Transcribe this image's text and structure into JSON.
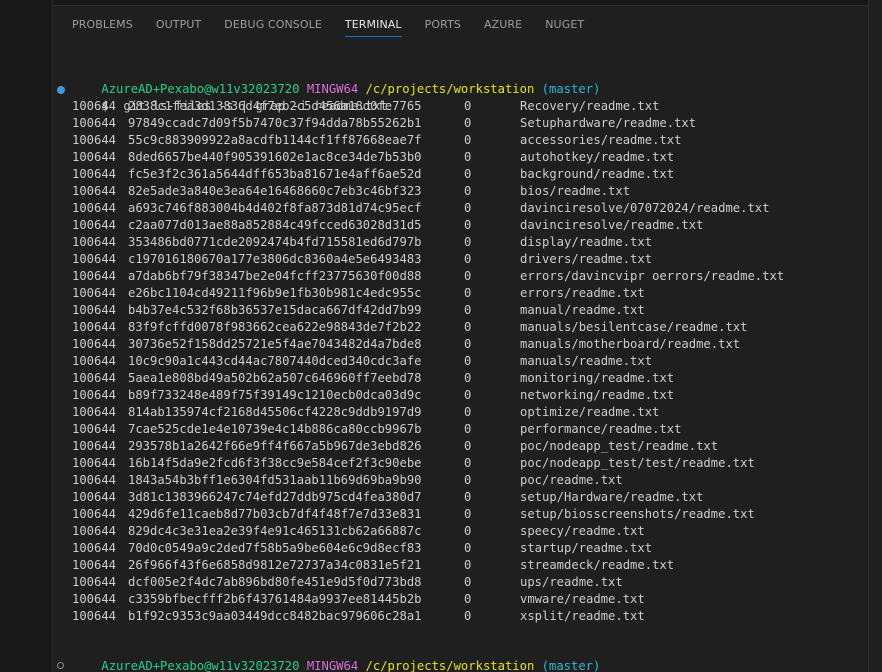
{
  "panel": {
    "tabs": [
      {
        "label": "PROBLEMS",
        "active": false
      },
      {
        "label": "OUTPUT",
        "active": false
      },
      {
        "label": "DEBUG CONSOLE",
        "active": false
      },
      {
        "label": "TERMINAL",
        "active": true
      },
      {
        "label": "PORTS",
        "active": false
      },
      {
        "label": "AZURE",
        "active": false
      },
      {
        "label": "NUGET",
        "active": false
      }
    ],
    "accent_color": "#0078d4"
  },
  "terminal": {
    "prompt1": {
      "user": "AzureAD+Pexabo@w11v32023720",
      "system": "MINGW64",
      "path": "/c/projects/workstation",
      "branch": "(master)"
    },
    "command": {
      "symbol": "$",
      "text": "git ls-files -s | grep -i readme.txt"
    },
    "rows": [
      {
        "mode": "100644",
        "hash": "2838c1fea3d13836d4f7eb2c5d456a18d0fe7765",
        "stage": "0",
        "file": "Recovery/readme.txt"
      },
      {
        "mode": "100644",
        "hash": "97849ccadc7d09f5b7470c37f94dda78b55262b1",
        "stage": "0",
        "file": "Setuphardware/readme.txt"
      },
      {
        "mode": "100644",
        "hash": "55c9c883909922a8acdfb1144cf1ff87668eae7f",
        "stage": "0",
        "file": "accessories/readme.txt"
      },
      {
        "mode": "100644",
        "hash": "8ded6657be440f905391602e1ac8ce34de7b53b0",
        "stage": "0",
        "file": "autohotkey/readme.txt"
      },
      {
        "mode": "100644",
        "hash": "fc5e3f2c361a5644dff653ba81671e4aff6ae52d",
        "stage": "0",
        "file": "background/readme.txt"
      },
      {
        "mode": "100644",
        "hash": "82e5ade3a840e3ea64e16468660c7eb3c46bf323",
        "stage": "0",
        "file": "bios/readme.txt"
      },
      {
        "mode": "100644",
        "hash": "a693c746f883004b4d402f8fa873d81d74c95ecf",
        "stage": "0",
        "file": "davinciresolve/07072024/readme.txt"
      },
      {
        "mode": "100644",
        "hash": "c2aa077d013ae88a852884c49fcced63028d31d5",
        "stage": "0",
        "file": "davinciresolve/readme.txt"
      },
      {
        "mode": "100644",
        "hash": "353486bd0771cde2092474b4fd715581ed6d797b",
        "stage": "0",
        "file": "display/readme.txt"
      },
      {
        "mode": "100644",
        "hash": "c197016180670a177e3806dc8360a4e5e6493483",
        "stage": "0",
        "file": "drivers/readme.txt"
      },
      {
        "mode": "100644",
        "hash": "a7dab6bf79f38347be2e04fcff23775630f00d88",
        "stage": "0",
        "file": "errors/davincvipr oerrors/readme.txt"
      },
      {
        "mode": "100644",
        "hash": "e26bc1104cd49211f96b9e1fb30b981c4edc955c",
        "stage": "0",
        "file": "errors/readme.txt"
      },
      {
        "mode": "100644",
        "hash": "b4b37e4c532f68b36537e15daca667df42dd7b99",
        "stage": "0",
        "file": "manual/readme.txt"
      },
      {
        "mode": "100644",
        "hash": "83f9fcffd0078f983662cea622e98843de7f2b22",
        "stage": "0",
        "file": "manuals/besilentcase/readme.txt"
      },
      {
        "mode": "100644",
        "hash": "30736e52f158dd25721e5f4ae7043482d4a7bde8",
        "stage": "0",
        "file": "manuals/motherboard/readme.txt"
      },
      {
        "mode": "100644",
        "hash": "10c9c90a1c443cd44ac7807440dced340cdc3afe",
        "stage": "0",
        "file": "manuals/readme.txt"
      },
      {
        "mode": "100644",
        "hash": "5aea1e808bd49a502b62a507c646960ff7eebd78",
        "stage": "0",
        "file": "monitoring/readme.txt"
      },
      {
        "mode": "100644",
        "hash": "b89f733248e489f75f39149c1210ecb0dca03d9c",
        "stage": "0",
        "file": "networking/readme.txt"
      },
      {
        "mode": "100644",
        "hash": "814ab135974cf2168d45506cf4228c9ddb9197d9",
        "stage": "0",
        "file": "optimize/readme.txt"
      },
      {
        "mode": "100644",
        "hash": "7cae525cde1e4e10739e4c14b886ca80ccb9967b",
        "stage": "0",
        "file": "performance/readme.txt"
      },
      {
        "mode": "100644",
        "hash": "293578b1a2642f66e9ff4f667a5b967de3ebd826",
        "stage": "0",
        "file": "poc/nodeapp_test/readme.txt"
      },
      {
        "mode": "100644",
        "hash": "16b14f5da9e2fcd6f3f38cc9e584cef2f3c90ebe",
        "stage": "0",
        "file": "poc/nodeapp_test/test/readme.txt"
      },
      {
        "mode": "100644",
        "hash": "1843a54b3bff1e6304fd531aab11b69d69ba9b90",
        "stage": "0",
        "file": "poc/readme.txt"
      },
      {
        "mode": "100644",
        "hash": "3d81c1383966247c74efd27ddb975cd4fea380d7",
        "stage": "0",
        "file": "setup/Hardware/readme.txt"
      },
      {
        "mode": "100644",
        "hash": "429d6fe11caeb8d77b03cb7df4f48f7e7d33e831",
        "stage": "0",
        "file": "setup/biosscreenshots/readme.txt"
      },
      {
        "mode": "100644",
        "hash": "829dc4c3e31ea2e39f4e91c465131cb62a66887c",
        "stage": "0",
        "file": "speecy/readme.txt"
      },
      {
        "mode": "100644",
        "hash": "70d0c0549a9c2ded7f58b5a9be604e6c9d8ecf83",
        "stage": "0",
        "file": "startup/readme.txt"
      },
      {
        "mode": "100644",
        "hash": "26f966f43f6e6858d9812e72737a34c0831e5f21",
        "stage": "0",
        "file": "streamdeck/readme.txt"
      },
      {
        "mode": "100644",
        "hash": "dcf005e2f4dc7ab896bd80fe451e9d5f0d773bd8",
        "stage": "0",
        "file": "ups/readme.txt"
      },
      {
        "mode": "100644",
        "hash": "c3359bfbecfff2b6f43761484a9937ee81445b2b",
        "stage": "0",
        "file": "vmware/readme.txt"
      },
      {
        "mode": "100644",
        "hash": "b1f92c9353c9aa03449dcc8482bac979606c28a1",
        "stage": "0",
        "file": "xsplit/readme.txt"
      }
    ],
    "prompt2": {
      "user": "AzureAD+Pexabo@w11v32023720",
      "system": "MINGW64",
      "path": "/c/projects/workstation",
      "branch": "(master)"
    },
    "input": {
      "symbol": "$",
      "text": ""
    },
    "colors": {
      "user": "#23d18b",
      "system": "#d670d6",
      "path": "#e5e510",
      "branch": "#29b8db",
      "text": "#cccccc",
      "background": "#1f1f1f"
    },
    "icons": {
      "command_decoration": "circle-filled-icon",
      "input_decoration": "circle-outline-icon"
    }
  }
}
